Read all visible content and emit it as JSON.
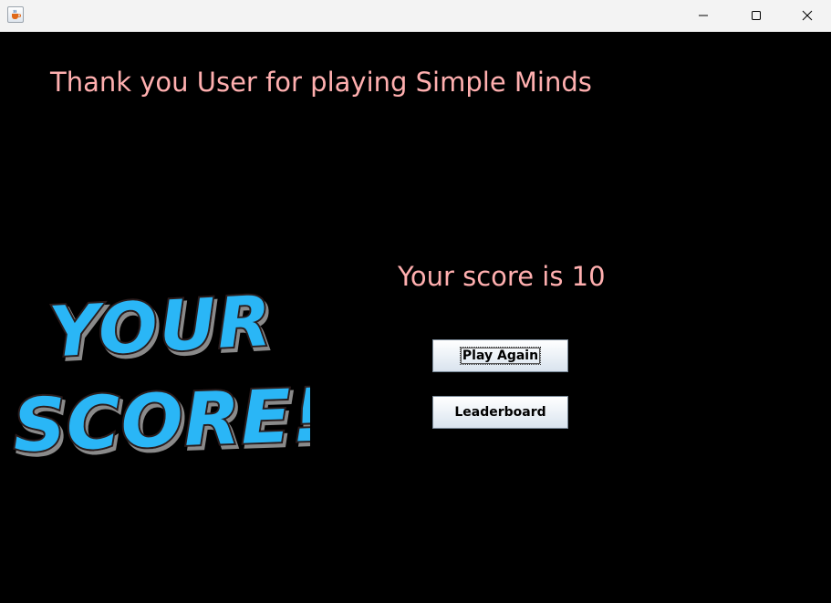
{
  "window": {
    "controls": {
      "minimize_icon": "minimize-icon",
      "maximize_icon": "maximize-icon",
      "close_icon": "close-icon"
    },
    "app_icon": "java-cup-icon"
  },
  "main": {
    "thank_you_message": "Thank you User for playing Simple Minds",
    "score_message": "Your score is 10",
    "score_image_text_line1": "YOUR",
    "score_image_text_line2": "SCORE!",
    "buttons": {
      "play_again_label": "Play Again",
      "leaderboard_label": "Leaderboard"
    }
  },
  "colors": {
    "background": "#000000",
    "message_text": "#ffafaf",
    "score_art_fill": "#29b6f6",
    "score_art_outline": "#2a1a1a"
  }
}
